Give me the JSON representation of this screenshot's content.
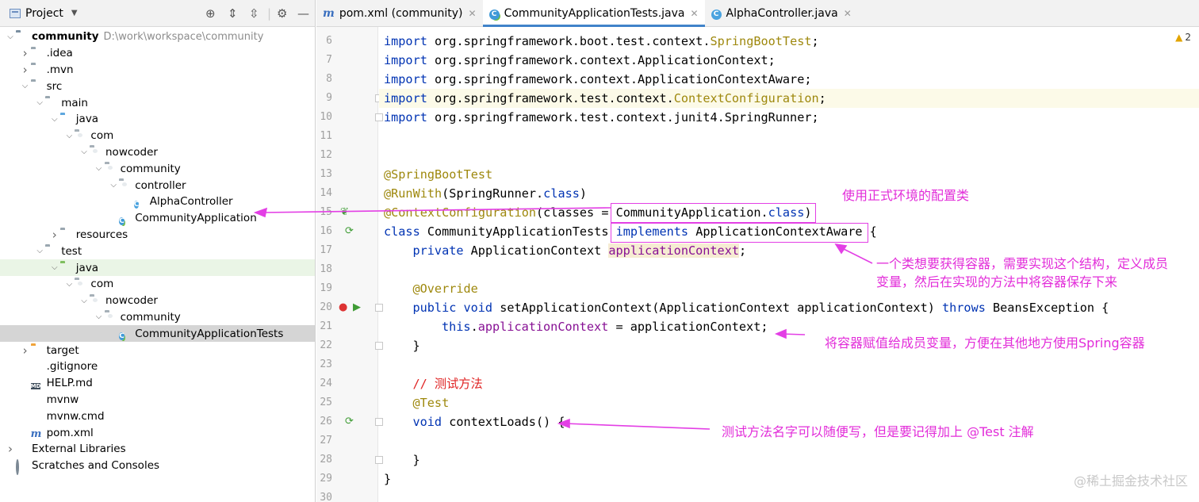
{
  "project_panel": {
    "title": "Project",
    "tree": [
      {
        "label": "community",
        "path": "D:\\work\\workspace\\community",
        "icon": "root-folder-icon",
        "depth": 0,
        "arrow": "down",
        "bold": true
      },
      {
        "label": ".idea",
        "icon": "folder-icon",
        "depth": 1,
        "arrow": "right"
      },
      {
        "label": ".mvn",
        "icon": "folder-icon",
        "depth": 1,
        "arrow": "right"
      },
      {
        "label": "src",
        "icon": "folder-icon",
        "depth": 1,
        "arrow": "down"
      },
      {
        "label": "main",
        "icon": "folder-icon",
        "depth": 2,
        "arrow": "down"
      },
      {
        "label": "java",
        "icon": "source-folder-icon",
        "depth": 3,
        "arrow": "down"
      },
      {
        "label": "com",
        "icon": "package-icon",
        "depth": 4,
        "arrow": "down"
      },
      {
        "label": "nowcoder",
        "icon": "package-icon",
        "depth": 5,
        "arrow": "down"
      },
      {
        "label": "community",
        "icon": "package-icon",
        "depth": 6,
        "arrow": "down"
      },
      {
        "label": "controller",
        "icon": "package-icon",
        "depth": 7,
        "arrow": "down"
      },
      {
        "label": "AlphaController",
        "icon": "class-icon",
        "depth": 8,
        "arrow": "none"
      },
      {
        "label": "CommunityApplication",
        "icon": "spring-class-icon",
        "depth": 7,
        "arrow": "none"
      },
      {
        "label": "resources",
        "icon": "resources-folder-icon",
        "depth": 3,
        "arrow": "right"
      },
      {
        "label": "test",
        "icon": "folder-icon",
        "depth": 2,
        "arrow": "down"
      },
      {
        "label": "java",
        "icon": "test-folder-icon",
        "depth": 3,
        "arrow": "down",
        "highlight": true
      },
      {
        "label": "com",
        "icon": "package-icon",
        "depth": 4,
        "arrow": "down"
      },
      {
        "label": "nowcoder",
        "icon": "package-icon",
        "depth": 5,
        "arrow": "down"
      },
      {
        "label": "community",
        "icon": "package-icon",
        "depth": 6,
        "arrow": "down"
      },
      {
        "label": "CommunityApplicationTests",
        "icon": "spring-class-icon",
        "depth": 7,
        "arrow": "none",
        "selected": true
      },
      {
        "label": "target",
        "icon": "excluded-folder-icon",
        "depth": 1,
        "arrow": "right"
      },
      {
        "label": ".gitignore",
        "icon": "gitignore-file-icon",
        "depth": 1,
        "arrow": "none"
      },
      {
        "label": "HELP.md",
        "icon": "markdown-file-icon",
        "depth": 1,
        "arrow": "none"
      },
      {
        "label": "mvnw",
        "icon": "file-icon",
        "depth": 1,
        "arrow": "none"
      },
      {
        "label": "mvnw.cmd",
        "icon": "file-icon",
        "depth": 1,
        "arrow": "none"
      },
      {
        "label": "pom.xml",
        "icon": "maven-file-icon",
        "depth": 1,
        "arrow": "none"
      },
      {
        "label": "External Libraries",
        "icon": "libraries-icon",
        "depth": 0,
        "arrow": "right"
      },
      {
        "label": "Scratches and Consoles",
        "icon": "scratches-icon",
        "depth": 0,
        "arrow": "none"
      }
    ]
  },
  "tabs": [
    {
      "label": "pom.xml (community)",
      "icon": "maven-file-icon",
      "active": false
    },
    {
      "label": "CommunityApplicationTests.java",
      "icon": "spring-class-icon",
      "active": true
    },
    {
      "label": "AlphaController.java",
      "icon": "class-icon",
      "active": false
    }
  ],
  "inspection": {
    "count": "2",
    "icon": "warning-icon"
  },
  "editor": {
    "lines": [
      {
        "n": "6",
        "indent": 0,
        "tokens": [
          [
            "kw",
            "import "
          ],
          [
            "",
            "org.springframework.boot.test.context."
          ],
          [
            "ann",
            "SpringBootTest"
          ],
          [
            "",
            ";"
          ]
        ]
      },
      {
        "n": "7",
        "indent": 0,
        "tokens": [
          [
            "kw",
            "import "
          ],
          [
            "",
            "org.springframework.context.ApplicationContext;"
          ]
        ]
      },
      {
        "n": "8",
        "indent": 0,
        "tokens": [
          [
            "kw",
            "import "
          ],
          [
            "",
            "org.springframework.context.ApplicationContextAware;"
          ]
        ]
      },
      {
        "n": "9",
        "indent": 0,
        "current": true,
        "tokens": [
          [
            "kw",
            "import "
          ],
          [
            "",
            "org.springframework.test.context."
          ],
          [
            "ann",
            "ContextConfiguration"
          ],
          [
            "",
            ";"
          ]
        ]
      },
      {
        "n": "10",
        "indent": 0,
        "tokens": [
          [
            "kw",
            "import "
          ],
          [
            "",
            "org.springframework.test.context.junit4.SpringRunner;"
          ]
        ]
      },
      {
        "n": "11",
        "indent": 0,
        "tokens": []
      },
      {
        "n": "12",
        "indent": 0,
        "tokens": []
      },
      {
        "n": "13",
        "indent": 0,
        "tokens": [
          [
            "ann",
            "@SpringBootTest"
          ]
        ]
      },
      {
        "n": "14",
        "indent": 0,
        "tokens": [
          [
            "ann",
            "@RunWith"
          ],
          [
            "",
            "(SpringRunner."
          ],
          [
            "kw",
            "class"
          ],
          [
            "",
            ")"
          ]
        ]
      },
      {
        "n": "15",
        "indent": 0,
        "tokens": [
          [
            "ann",
            "@ContextConfiguration"
          ],
          [
            "",
            "(classes = CommunityApplication."
          ],
          [
            "kw",
            "class"
          ],
          [
            "",
            ")"
          ]
        ]
      },
      {
        "n": "16",
        "indent": 0,
        "tokens": [
          [
            "kw",
            "class "
          ],
          [
            "",
            "CommunityApplicationTests "
          ],
          [
            "kw",
            "implements "
          ],
          [
            "",
            "ApplicationContextAware {"
          ]
        ]
      },
      {
        "n": "17",
        "indent": 1,
        "tokens": [
          [
            "kw",
            "private "
          ],
          [
            "",
            "ApplicationContext "
          ],
          [
            "fld field-hl",
            "applicationContext"
          ],
          [
            "",
            ";"
          ]
        ]
      },
      {
        "n": "18",
        "indent": 0,
        "tokens": []
      },
      {
        "n": "19",
        "indent": 1,
        "tokens": [
          [
            "ann",
            "@Override"
          ]
        ]
      },
      {
        "n": "20",
        "indent": 1,
        "tokens": [
          [
            "kw",
            "public void "
          ],
          [
            "",
            "setApplicationContext(ApplicationContext applicationContext) "
          ],
          [
            "kw",
            "throws "
          ],
          [
            "",
            "BeansException {"
          ]
        ]
      },
      {
        "n": "21",
        "indent": 2,
        "tokens": [
          [
            "kw",
            "this"
          ],
          [
            "",
            "."
          ],
          [
            "fld",
            "applicationContext"
          ],
          [
            "",
            " = applicationContext;"
          ]
        ]
      },
      {
        "n": "22",
        "indent": 1,
        "tokens": [
          [
            "",
            "}"
          ]
        ]
      },
      {
        "n": "23",
        "indent": 0,
        "tokens": []
      },
      {
        "n": "24",
        "indent": 1,
        "tokens": [
          [
            "cmt",
            "// 测试方法"
          ]
        ]
      },
      {
        "n": "25",
        "indent": 1,
        "tokens": [
          [
            "ann",
            "@Test"
          ]
        ]
      },
      {
        "n": "26",
        "indent": 1,
        "tokens": [
          [
            "kw",
            "void "
          ],
          [
            "",
            "contextLoads() {"
          ]
        ]
      },
      {
        "n": "27",
        "indent": 0,
        "tokens": []
      },
      {
        "n": "28",
        "indent": 1,
        "tokens": [
          [
            "",
            "}"
          ]
        ]
      },
      {
        "n": "29",
        "indent": 0,
        "tokens": [
          [
            "",
            "}"
          ]
        ]
      },
      {
        "n": "30",
        "indent": 0,
        "tokens": []
      }
    ]
  },
  "annotations": {
    "note_config": "使用正式环境的配置类",
    "note_container_line1": "一个类想要获得容器，需要实现这个结构，定义成员",
    "note_container_line2": "变量，然后在实现的方法中将容器保存下来",
    "note_assign": "将容器赋值给成员变量，方便在其他地方使用Spring容器",
    "note_test": "测试方法名字可以随便写，但是要记得加上 @Test 注解",
    "color": "#e33fe5"
  },
  "watermark": "@稀土掘金技术社区"
}
